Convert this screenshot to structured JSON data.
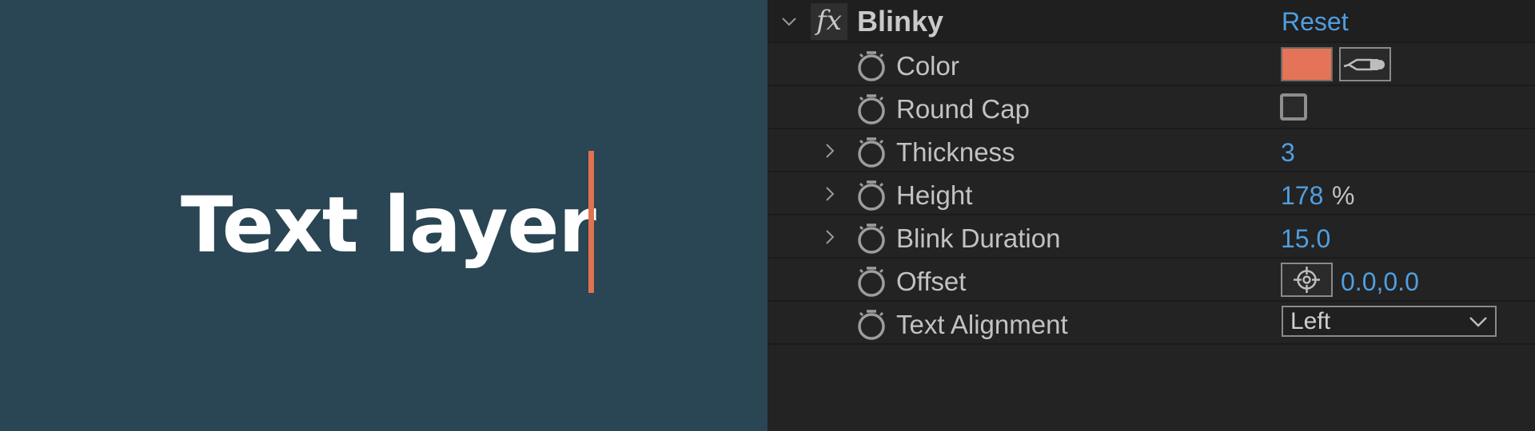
{
  "preview": {
    "text": "Text layer",
    "cursor_color": "#e07252"
  },
  "effect": {
    "name": "Blinky",
    "fx_label": "fx",
    "reset_label": "Reset"
  },
  "properties": [
    {
      "label": "Color",
      "control": "color",
      "value_color": "#e57357",
      "icon": "eyedropper-icon"
    },
    {
      "label": "Round Cap",
      "control": "checkbox",
      "checked": false
    },
    {
      "label": "Thickness",
      "control": "number",
      "value": "3"
    },
    {
      "label": "Height",
      "control": "number",
      "value": "178",
      "unit": "%"
    },
    {
      "label": "Blink Duration",
      "control": "number",
      "value": "15.0"
    },
    {
      "label": "Offset",
      "control": "point",
      "value": "0.0,0.0",
      "icon": "crosshair-icon"
    },
    {
      "label": "Text Alignment",
      "control": "dropdown",
      "value": "Left"
    }
  ],
  "colors": {
    "accent": "#4f9fe0",
    "background_preview": "#2a4553",
    "panel": "#232323"
  }
}
